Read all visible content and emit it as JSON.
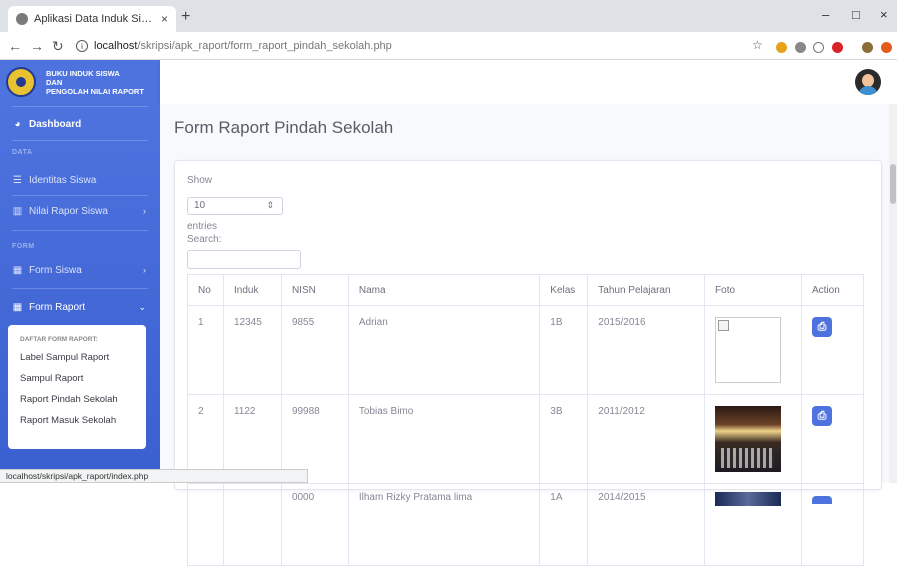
{
  "browser": {
    "tab_title": "Aplikasi Data Induk Siswa Dan N",
    "tab_close": "×",
    "new_tab": "+",
    "url_host": "localhost",
    "url_path": "/skripsi/apk_raport/form_raport_pindah_sekolah.php",
    "win_min": "–",
    "win_max": "□",
    "win_close": "×",
    "status_url": "localhost/skripsi/apk_raport/index.php"
  },
  "sidebar": {
    "brand_line1": "BUKU INDUK SISWA",
    "brand_line2": "DAN",
    "brand_line3": "PENGOLAH NILAI RAPORT",
    "dashboard": "Dashboard",
    "heading_data": "DATA",
    "identitas_siswa": "Identitas Siswa",
    "nilai_rapor_siswa": "Nilai Rapor Siswa",
    "heading_form": "FORM",
    "form_siswa": "Form Siswa",
    "form_raport": "Form Raport",
    "submenu": {
      "heading": "DAFTAR FORM RAPORT:",
      "items": [
        "Label Sampul Raport",
        "Sampul Raport",
        "Raport Pindah Sekolah",
        "Raport Masuk Sekolah"
      ]
    }
  },
  "page": {
    "title": "Form Raport Pindah Sekolah",
    "show_label": "Show",
    "entries_value": "10",
    "entries_label": "entries",
    "search_label": "Search:"
  },
  "table": {
    "headers": [
      "No",
      "Induk",
      "NISN",
      "Nama",
      "Kelas",
      "Tahun Pelajaran",
      "Foto",
      "Action"
    ],
    "rows": [
      {
        "no": "1",
        "induk": "12345",
        "nisn": "9855",
        "nama": "Adrian",
        "kelas": "1B",
        "tahun": "2015/2016"
      },
      {
        "no": "2",
        "induk": "1122",
        "nisn": "99988",
        "nama": "Tobias Bimo",
        "kelas": "3B",
        "tahun": "2011/2012"
      },
      {
        "no": "",
        "induk": "",
        "nisn": "0000",
        "nama": "Ilham Rizky Pratama lima",
        "kelas": "1A",
        "tahun": "2014/2015"
      }
    ]
  },
  "colors": {
    "sidebar": "#4e73df",
    "accent": "#4e73df",
    "background": "#f8f9fc"
  }
}
